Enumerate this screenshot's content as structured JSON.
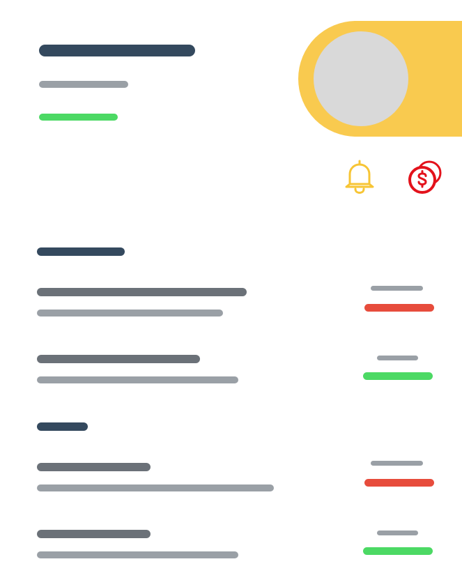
{
  "colors": {
    "title_dark": "#34495e",
    "muted_gray": "#9aa0a6",
    "dark_gray": "#6b7178",
    "green": "#4cd964",
    "red": "#e74c3c",
    "toggle_yellow": "#f9ca4f",
    "knob_gray": "#d9d9d9",
    "bell_yellow": "#f7c535",
    "coin_red": "#e3121b"
  },
  "icons": {
    "bell": "bell-icon",
    "coins": "dollar-coins-icon"
  },
  "toggle": {
    "state": "on"
  }
}
